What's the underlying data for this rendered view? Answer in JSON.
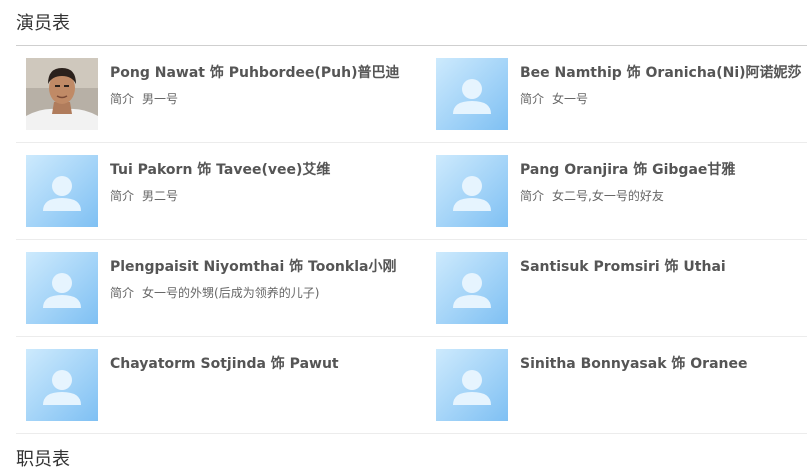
{
  "cast_section": {
    "title": "演员表",
    "desc_label": "简介",
    "members": [
      {
        "name": "Pong Nawat 饰 Puhbordee(Puh)普巴迪",
        "desc": "男一号",
        "has_photo": true
      },
      {
        "name": "Bee Namthip 饰 Oranicha(Ni)阿诺妮莎",
        "desc": "女一号",
        "has_photo": false
      },
      {
        "name": "Tui Pakorn 饰 Tavee(vee)艾维",
        "desc": "男二号",
        "has_photo": false
      },
      {
        "name": "Pang Oranjira 饰 Gibgae甘雅",
        "desc": "女二号,女一号的好友",
        "has_photo": false
      },
      {
        "name": "Plengpaisit Niyomthai 饰 Toonkla小刚",
        "desc": "女一号的外甥(后成为领养的儿子)",
        "has_photo": false
      },
      {
        "name": "Santisuk Promsiri 饰 Uthai",
        "desc": "",
        "has_photo": false
      },
      {
        "name": "Chayatorm Sotjinda 饰 Pawut",
        "desc": "",
        "has_photo": false
      },
      {
        "name": "Sinitha Bonnyasak 饰 Oranee",
        "desc": "",
        "has_photo": false
      }
    ]
  },
  "staff_section": {
    "title": "职员表"
  },
  "colors": {
    "placeholder_light": "#cdeafd",
    "placeholder_dark": "#7fc0f3",
    "placeholder_figure": "#e6f4fe",
    "divider": "#ececec",
    "title_rule": "#cfcfcf"
  }
}
